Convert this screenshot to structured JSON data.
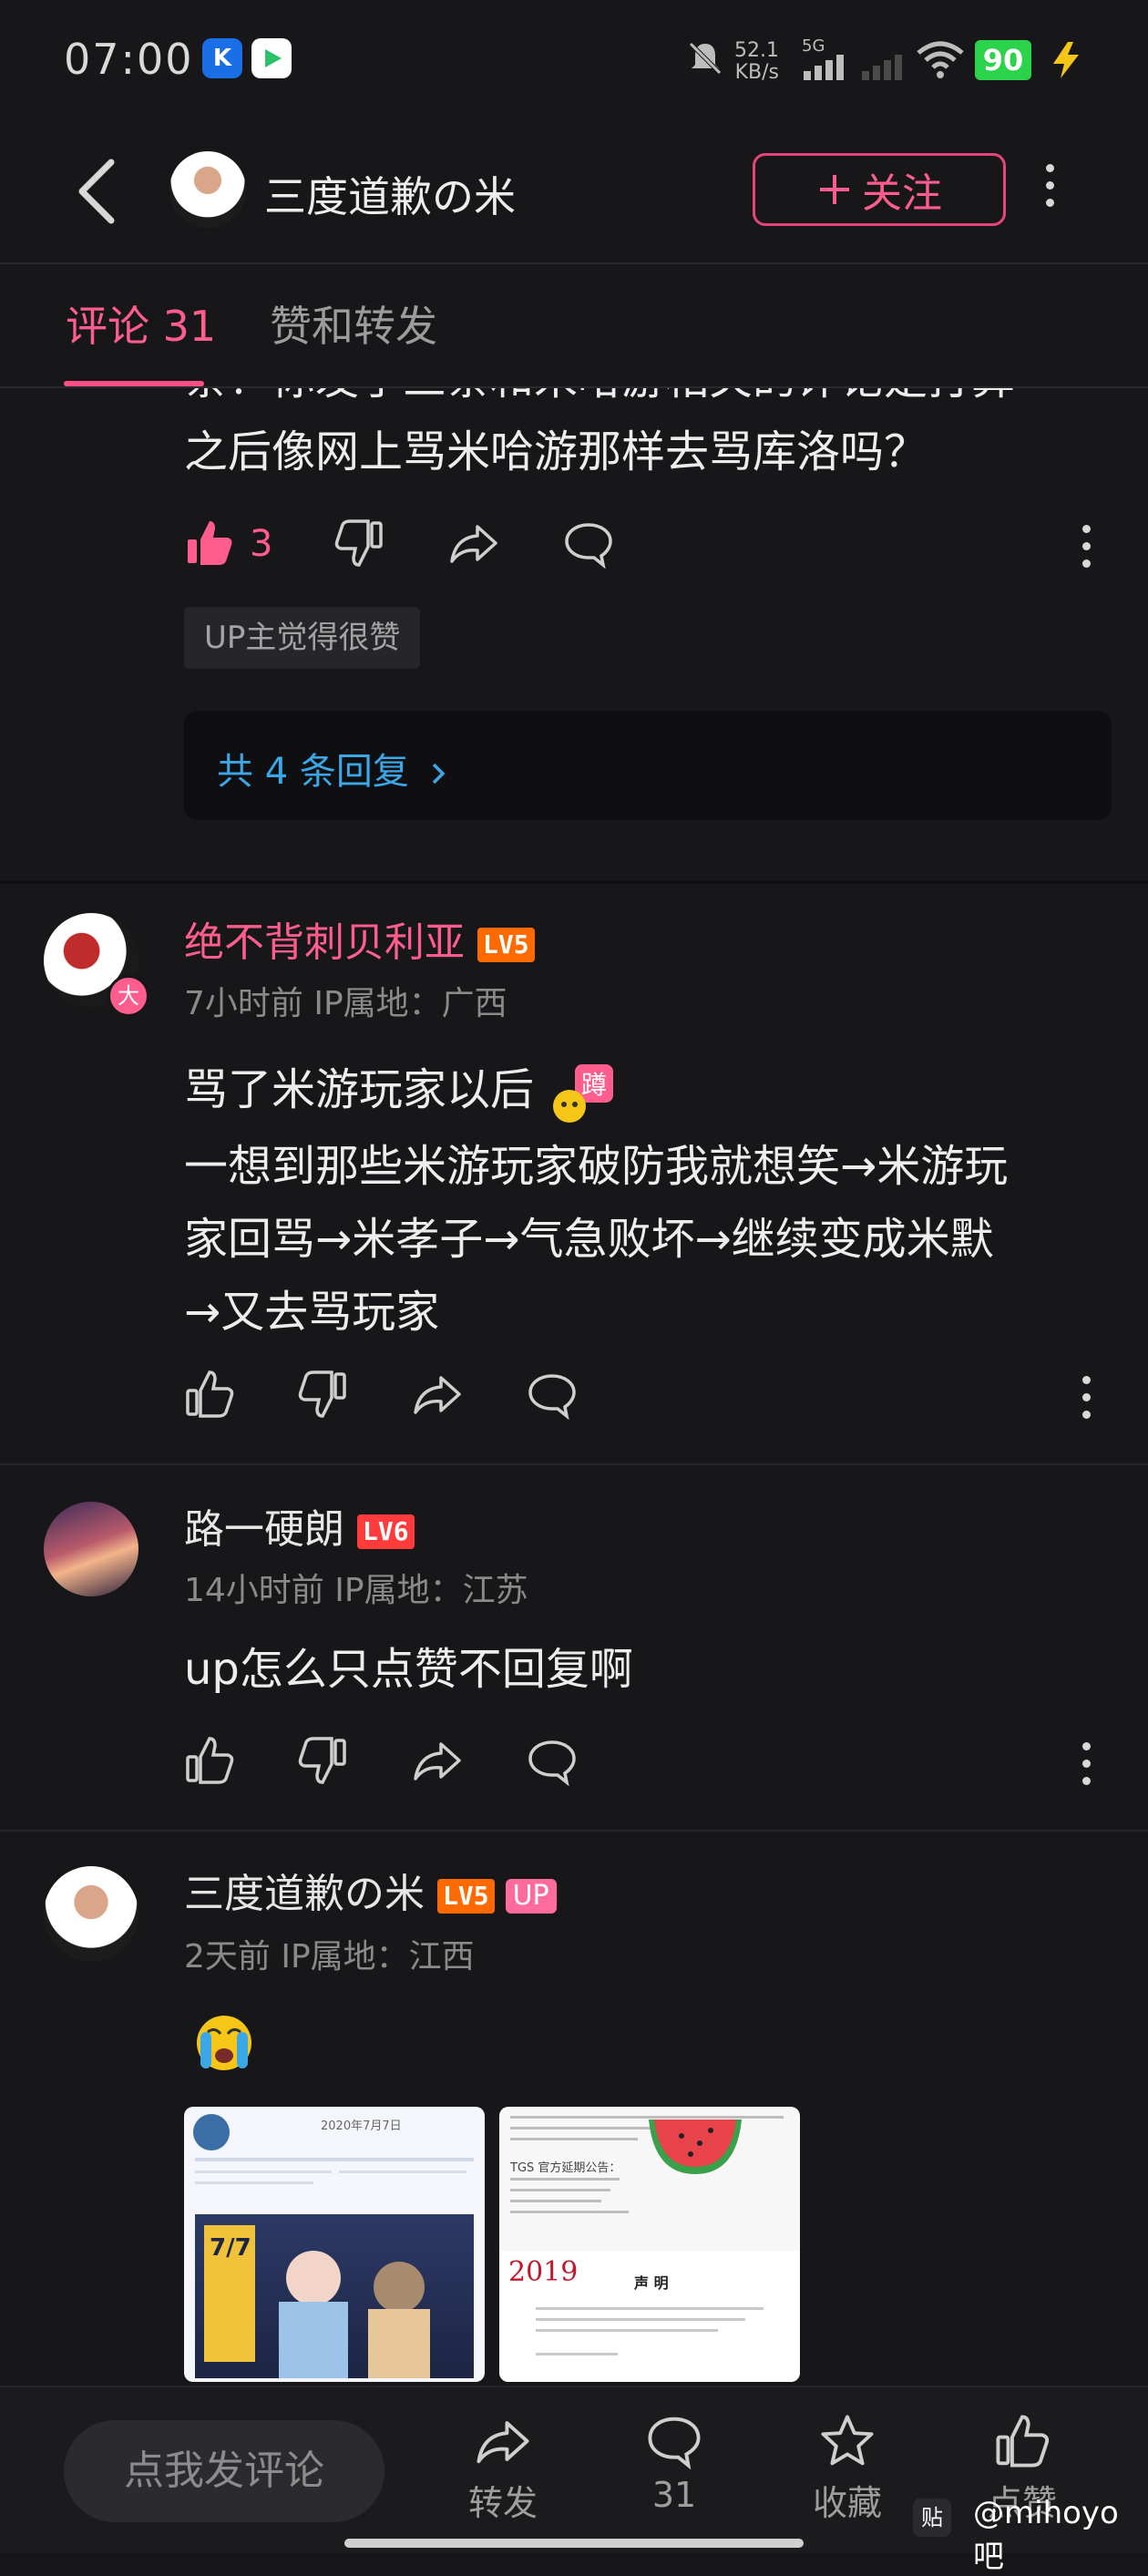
{
  "status_bar": {
    "time": "07:00",
    "net_speed": "52.1",
    "net_unit": "KB/s",
    "signal_label": "5G",
    "battery": "90"
  },
  "header": {
    "title": "三度道歉の米",
    "follow_label": "关注"
  },
  "tabs": [
    {
      "label": "评论 31",
      "active": true
    },
    {
      "label": "赞和转发",
      "active": false
    }
  ],
  "comments": [
    {
      "partial_text_line1": "条！你发了三条和米哈游相关的评论是打算",
      "partial_text_line2": "之后像网上骂米哈游那样去骂库洛吗？",
      "likes": "3",
      "up_liked": "UP主觉得很赞",
      "replies": "共 4 条回复"
    },
    {
      "username": "绝不背刺贝利亚",
      "level": "LV5",
      "meta": "7小时前 IP属地：广西",
      "avatar_badge": "大",
      "lines": [
        "骂了米游玩家以后",
        "一想到那些米游玩家破防我就想笑→米游玩",
        "家回骂→米孝子→气急败坏→继续变成米默",
        "→又去骂玩家"
      ]
    },
    {
      "username": "路一硬朗",
      "level": "LV6",
      "meta": "14小时前 IP属地：江苏",
      "text": "up怎么只点赞不回复啊"
    },
    {
      "username": "三度道歉の米",
      "level": "LV5",
      "up_badge": "UP",
      "meta": "2天前 IP属地：江西",
      "image1": {
        "caption_top": "2020年7月7日",
        "date_big": "7/7"
      },
      "image2": {
        "heading_text": "TGS 官方延期公告：",
        "year": "2019",
        "title": "声 明"
      }
    }
  ],
  "bottom_bar": {
    "comment_placeholder": "点我发评论",
    "forward": "转发",
    "comments": "31",
    "collect": "收藏",
    "like": "点赞"
  },
  "watermark": "@mihoyo吧",
  "colors": {
    "accent": "#ff5d8d",
    "lv5": "#ff6a00",
    "lv6": "#ff3b3b",
    "link": "#3ba7e6"
  }
}
